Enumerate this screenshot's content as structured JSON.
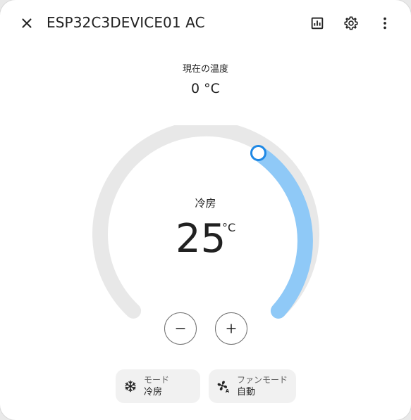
{
  "dialog": {
    "title": "ESP32C3DEVICE01 AC"
  },
  "header_icons": {
    "close": "close-icon",
    "history": "chart-icon",
    "settings": "gear-icon",
    "more": "more-vertical-icon"
  },
  "current": {
    "label": "現在の温度",
    "value": "0 °C"
  },
  "thermostat": {
    "mode_label": "冷房",
    "target_value": "25",
    "unit": "°C",
    "colors": {
      "track": "#e8e8e8",
      "active": "#8fc9f7",
      "handle": "#1e88e5"
    }
  },
  "controls": {
    "decrease": "minus-icon",
    "increase": "plus-icon"
  },
  "chips": {
    "mode": {
      "title": "モード",
      "value": "冷房",
      "icon": "snowflake-icon"
    },
    "fan": {
      "title": "ファンモード",
      "value": "自動",
      "icon": "fan-auto-icon"
    }
  }
}
